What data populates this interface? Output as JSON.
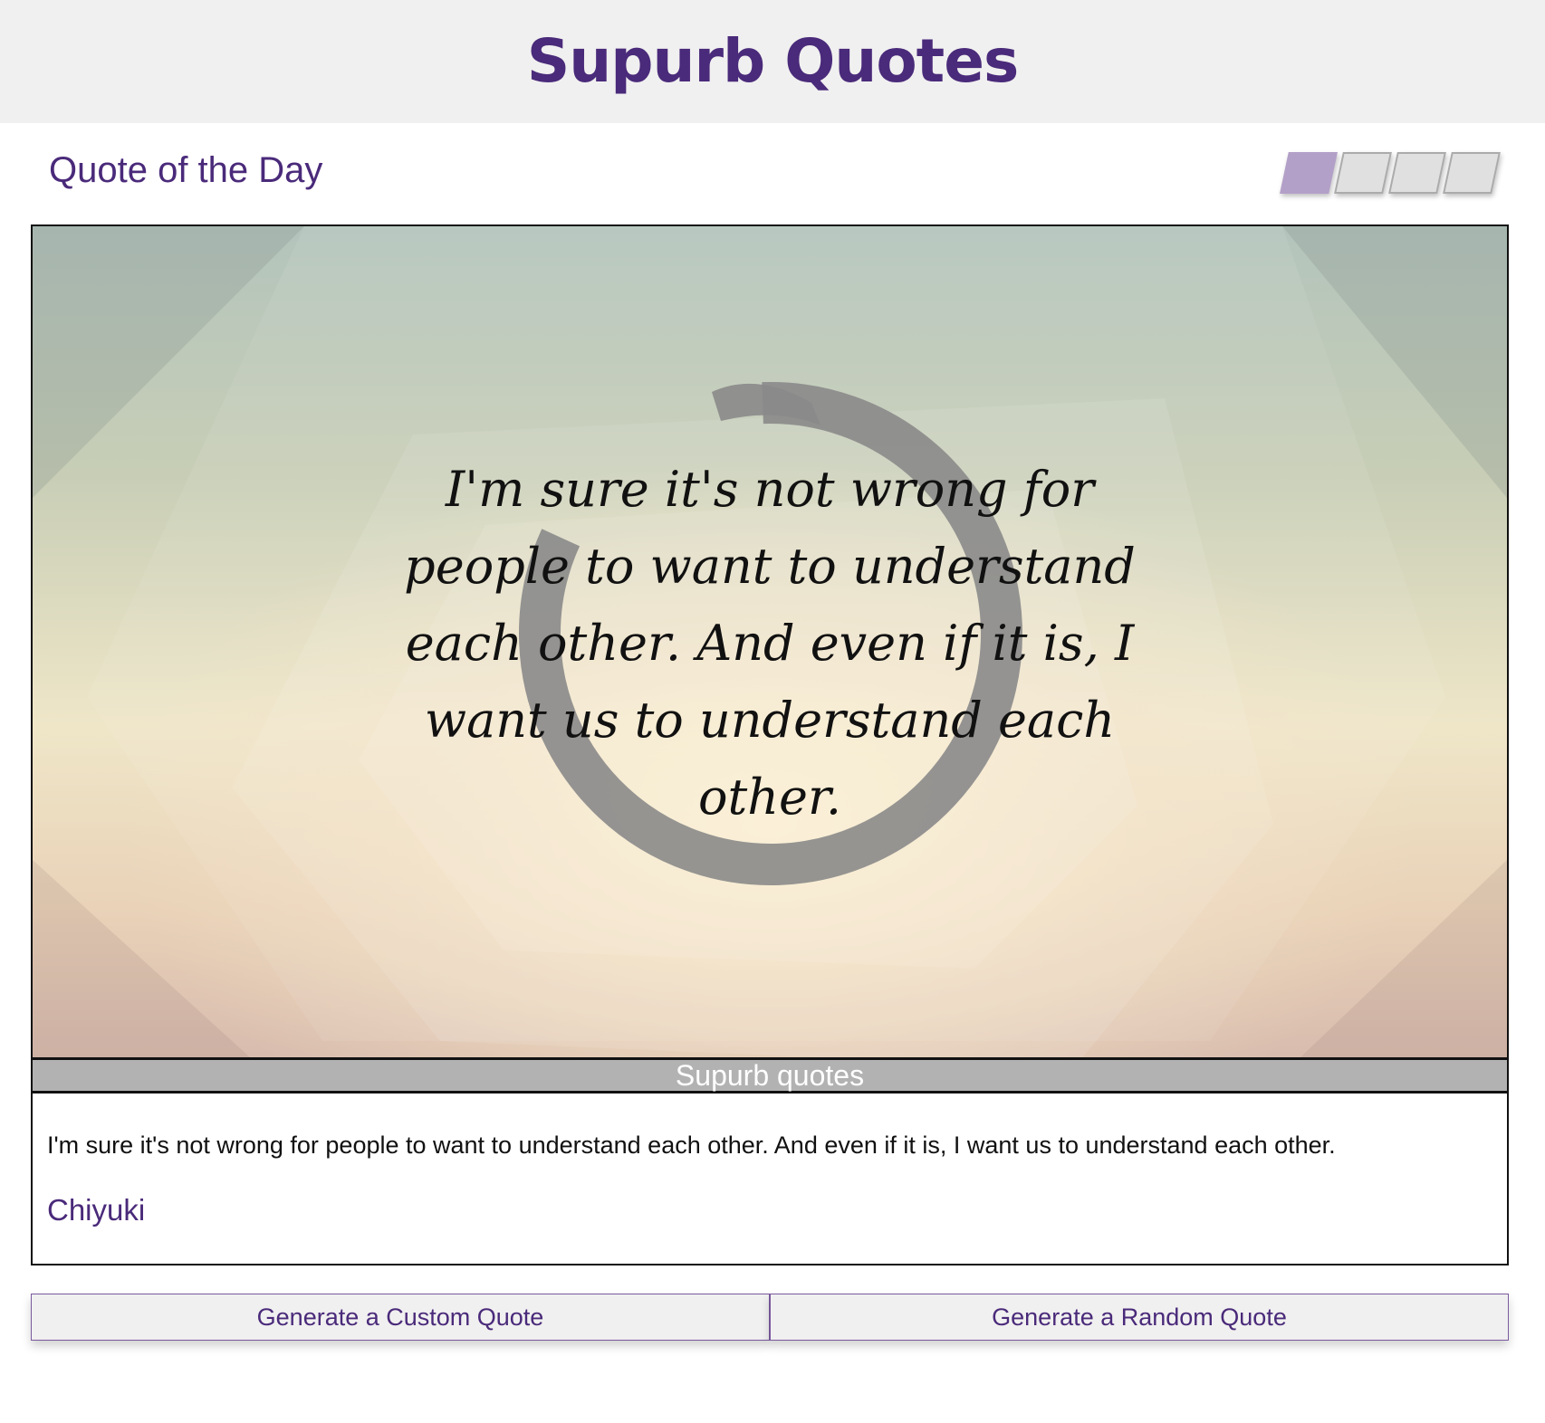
{
  "header": {
    "title": "Supurb Quotes"
  },
  "section": {
    "title": "Quote of the Day"
  },
  "theme_picker": {
    "count": 4,
    "active_index": 0,
    "active_color": "#b3a0c8",
    "inactive_color": "#e0e0e0"
  },
  "quote_card": {
    "image_quote": "I'm sure it's not wrong for people to want to understand each other. And even if it is, I want us to understand each other.",
    "caption": "Supurb quotes",
    "text": "I'm sure it's not wrong for people to want to understand each other. And even if it is, I want us to understand each other.",
    "author": "Chiyuki"
  },
  "buttons": {
    "custom_label": "Generate a Custom Quote",
    "random_label": "Generate a Random Quote"
  },
  "colors": {
    "brand": "#4a2a7a",
    "header_bg": "#f0f0f0",
    "caption_bg": "#b2b2b2"
  }
}
